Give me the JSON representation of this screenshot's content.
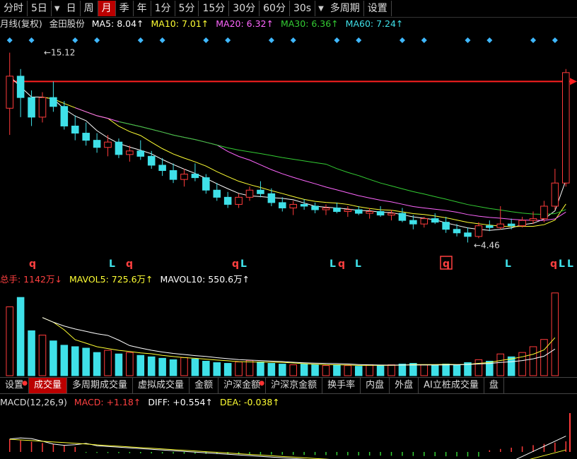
{
  "toolbar": {
    "items": [
      "分时",
      "5日",
      "日",
      "周",
      "月",
      "季",
      "年",
      "1分",
      "5分",
      "15分",
      "30分",
      "60分",
      "30s",
      "多周期",
      "设置"
    ],
    "active": "月"
  },
  "price_legend": {
    "title": "月线(复权)",
    "stock": "金田股份",
    "ma5": "MA5: 8.04↑",
    "ma10": "MA10: 7.01↑",
    "ma20": "MA20: 6.32↑",
    "ma30": "MA30: 6.36↑",
    "ma60": "MA60: 7.24↑"
  },
  "volume_legend": {
    "total": "总手: 1142万↓",
    "mavol5": "MAVOL5: 725.6万↑",
    "mavol10": "MAVOL10: 550.6万↑"
  },
  "macd_legend": {
    "title": "MACD(12,26,9)",
    "macd": "MACD: +1.18↑",
    "diff": "DIFF: +0.554↑",
    "dea": "DEA: -0.038↑"
  },
  "annotations": {
    "high": "15.12",
    "low": "4.46"
  },
  "signal_labels": [
    "q",
    "L",
    "q",
    "q",
    "L",
    "L",
    "q",
    "L",
    "q",
    "L",
    "q",
    "L",
    "L"
  ],
  "subtabs": [
    "设置",
    "成交量",
    "多周期成交量",
    "虚拟成交量",
    "金额",
    "沪深金额",
    "沪深京金额",
    "换手率",
    "内盘",
    "外盘",
    "AI立桩成交量",
    "盘"
  ],
  "subtab_active": "成交量",
  "colors": {
    "up": "#ff3b3b",
    "down": "#3fe0e8",
    "ma5": "#ffffff",
    "ma10": "#ffff33",
    "ma20": "#ff66ff",
    "ma30": "#33cc33",
    "ma60": "#3fe0e8",
    "arrow": "#ff2020",
    "diamond": "#3fb8ff"
  },
  "chart_data": {
    "type": "candlestick",
    "series_ohlc": [
      [
        12.0,
        15.12,
        10.5,
        13.8
      ],
      [
        13.8,
        14.2,
        11.5,
        12.6
      ],
      [
        12.6,
        13.0,
        11.0,
        11.5
      ],
      [
        11.5,
        12.9,
        11.2,
        12.6
      ],
      [
        12.6,
        13.5,
        11.8,
        12.1
      ],
      [
        12.1,
        12.4,
        10.8,
        11.0
      ],
      [
        11.0,
        11.6,
        10.2,
        10.6
      ],
      [
        10.6,
        11.2,
        9.9,
        10.2
      ],
      [
        10.2,
        10.6,
        9.5,
        9.8
      ],
      [
        9.8,
        10.5,
        9.3,
        10.1
      ],
      [
        10.1,
        10.3,
        9.2,
        9.4
      ],
      [
        9.4,
        9.9,
        9.0,
        9.6
      ],
      [
        9.6,
        10.2,
        9.1,
        9.3
      ],
      [
        9.3,
        9.6,
        8.6,
        8.8
      ],
      [
        8.8,
        9.2,
        8.2,
        8.5
      ],
      [
        8.5,
        8.9,
        7.8,
        8.0
      ],
      [
        8.0,
        8.6,
        7.6,
        8.3
      ],
      [
        8.3,
        8.9,
        7.9,
        8.1
      ],
      [
        8.1,
        8.3,
        7.2,
        7.4
      ],
      [
        7.4,
        7.8,
        6.8,
        7.0
      ],
      [
        7.0,
        7.3,
        6.4,
        6.6
      ],
      [
        6.6,
        7.2,
        6.4,
        7.0
      ],
      [
        7.0,
        7.6,
        6.8,
        7.4
      ],
      [
        7.4,
        7.9,
        7.0,
        7.2
      ],
      [
        7.2,
        7.5,
        6.5,
        6.7
      ],
      [
        6.7,
        7.0,
        6.2,
        6.4
      ],
      [
        6.4,
        6.8,
        6.0,
        6.6
      ],
      [
        6.6,
        6.9,
        6.3,
        6.5
      ],
      [
        6.5,
        6.7,
        6.1,
        6.3
      ],
      [
        6.3,
        6.6,
        6.0,
        6.4
      ],
      [
        6.4,
        6.7,
        6.1,
        6.2
      ],
      [
        6.2,
        6.5,
        5.9,
        6.3
      ],
      [
        6.3,
        6.5,
        6.0,
        6.1
      ],
      [
        6.1,
        6.4,
        5.8,
        6.2
      ],
      [
        6.2,
        6.5,
        5.9,
        6.0
      ],
      [
        6.0,
        6.3,
        5.7,
        6.1
      ],
      [
        6.1,
        6.4,
        5.6,
        5.7
      ],
      [
        5.7,
        6.0,
        5.2,
        5.5
      ],
      [
        5.5,
        5.9,
        5.3,
        5.8
      ],
      [
        5.8,
        6.1,
        5.5,
        5.6
      ],
      [
        5.6,
        5.9,
        5.0,
        5.2
      ],
      [
        5.2,
        5.5,
        4.8,
        5.0
      ],
      [
        5.0,
        5.3,
        4.46,
        4.8
      ],
      [
        4.8,
        5.6,
        4.7,
        5.4
      ],
      [
        5.4,
        5.7,
        5.1,
        5.3
      ],
      [
        5.3,
        6.5,
        5.2,
        5.5
      ],
      [
        5.5,
        5.8,
        5.2,
        5.4
      ],
      [
        5.4,
        5.9,
        5.3,
        5.7
      ],
      [
        5.7,
        6.2,
        5.5,
        5.8
      ],
      [
        5.8,
        6.8,
        5.6,
        6.5
      ],
      [
        6.5,
        8.6,
        6.3,
        7.8
      ],
      [
        7.8,
        14.2,
        7.6,
        14.0
      ]
    ],
    "volume": [
      950,
      1080,
      620,
      560,
      480,
      420,
      400,
      380,
      320,
      350,
      300,
      320,
      280,
      260,
      240,
      220,
      250,
      230,
      200,
      180,
      170,
      190,
      210,
      190,
      170,
      160,
      150,
      160,
      150,
      140,
      150,
      140,
      130,
      150,
      140,
      150,
      160,
      170,
      150,
      140,
      160,
      150,
      180,
      220,
      200,
      300,
      260,
      320,
      400,
      500,
      1142
    ]
  }
}
